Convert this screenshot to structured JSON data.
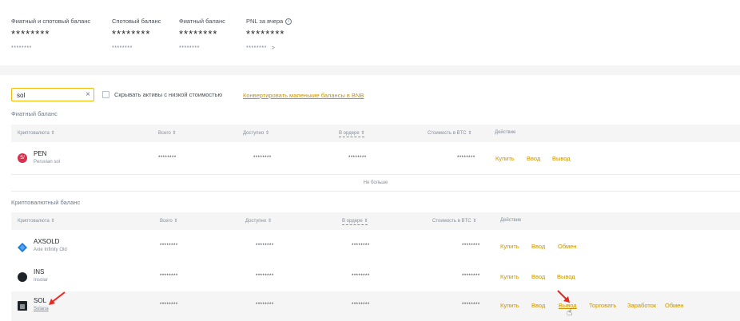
{
  "summary": [
    {
      "label": "Фиатный и спотовый баланс",
      "value": "********",
      "sub": "********"
    },
    {
      "label": "Спотовый баланс",
      "value": "********",
      "sub": "********"
    },
    {
      "label": "Фиатный баланс",
      "value": "********",
      "sub": "********"
    },
    {
      "label": "PNL за вчера",
      "value": "********",
      "sub": "********",
      "sub_arrow": ">"
    }
  ],
  "search": {
    "value": "sol"
  },
  "filters": {
    "hide_small_label": "Скрывать активы с низкой стоимостью",
    "convert_label": "Конвертировать маленькие балансы в BNB"
  },
  "fiat_section": {
    "title": "Фиатный баланс",
    "columns": [
      "Криптовалюта ⇕",
      "Всего ⇕",
      "Доступно ⇕",
      "В ордере ⇕",
      "Стоимость в BTC ⇕",
      "Действие"
    ],
    "rows": [
      {
        "symbol": "PEN",
        "name": "Peruvian sol",
        "total": "********",
        "available": "********",
        "in_order": "********",
        "btc_value": "********",
        "actions": [
          "Купить",
          "Ввод",
          "Вывод"
        ]
      }
    ],
    "no_more": "Не больше"
  },
  "crypto_section": {
    "title": "Криптовалютный баланс",
    "columns": [
      "Криптовалюта ⇕",
      "Всего ⇕",
      "Доступно ⇕",
      "В ордере ⇕",
      "Стоимость в BTC ⇕",
      "Действие"
    ],
    "rows": [
      {
        "symbol": "AXSOLD",
        "name": "Axie Infinity Old",
        "total": "********",
        "available": "********",
        "in_order": "********",
        "btc_value": "********",
        "actions": [
          "Купить",
          "Ввод",
          "Обмен"
        ]
      },
      {
        "symbol": "INS",
        "name": "Insolar",
        "total": "********",
        "available": "********",
        "in_order": "********",
        "btc_value": "********",
        "actions": [
          "Купить",
          "Ввод",
          "Вывод"
        ]
      },
      {
        "symbol": "SOL",
        "name": "Solana",
        "total": "********",
        "available": "********",
        "in_order": "********",
        "btc_value": "********",
        "actions": [
          "Купить",
          "Ввод",
          "Вывод",
          "Торговать",
          "Заработок",
          "Обмен"
        ]
      }
    ]
  },
  "colors": {
    "accent": "#c99400",
    "search_border": "#f0b90b",
    "arrow": "#e8271e",
    "pen_icon": "#d9304e",
    "axs_icon": "#1e7cd8"
  }
}
